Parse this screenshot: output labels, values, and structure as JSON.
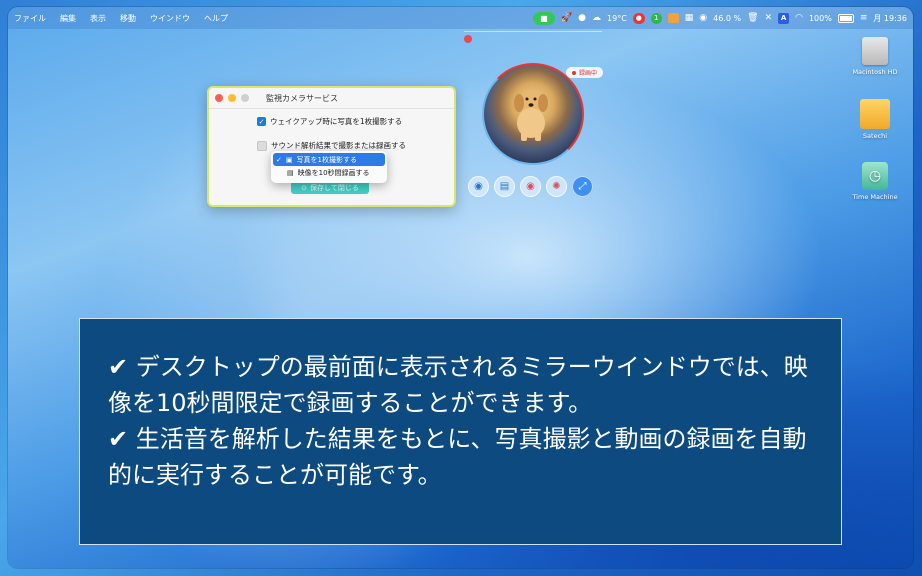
{
  "menubar": {
    "menus": [
      "ファイル",
      "編集",
      "表示",
      "移動",
      "ウインドウ",
      "ヘルプ"
    ],
    "weather": "19°C",
    "badge_number": "1",
    "percent": "46.0 %",
    "battery": "100%",
    "clock": "月 19:36",
    "icons": [
      "facetime-icon",
      "rocket-icon",
      "bulb-icon",
      "cloud-icon",
      "notification-icon",
      "calendar-icon",
      "storage-icon",
      "trash-icon",
      "tool-icon",
      "input-a-icon",
      "wifi-icon",
      "battery-icon",
      "control-center-icon"
    ]
  },
  "window": {
    "title": "監視カメラサービス",
    "option1": "ウェイクアップ時に写真を1枚撮影する",
    "option2": "サウンド解析結果で撮影または録画する",
    "save_button": "保存して閉じる"
  },
  "dropdown": {
    "items": [
      "写真を1枚撮影する",
      "映像を10秒間録画する"
    ],
    "selected_index": 0
  },
  "camera": {
    "status": "録画中"
  },
  "desktop": {
    "icons": [
      {
        "label": "Macintosh HD"
      },
      {
        "label": "Satechi"
      },
      {
        "label": "Time Machine"
      }
    ]
  },
  "caption": {
    "line1": "✔ デスクトップの最前面に表示されるミラーウインドウでは、映像を10秒間限定で録画することができます。",
    "line2": "✔ 生活音を解析した結果をもとに、写真撮影と動画の録画を自動的に実行することが可能です。"
  },
  "colors": {
    "caption_bg": "#0c4a80",
    "accent": "#1f7ae0",
    "record": "#e23a3a",
    "save_button": "#43d1c7"
  }
}
